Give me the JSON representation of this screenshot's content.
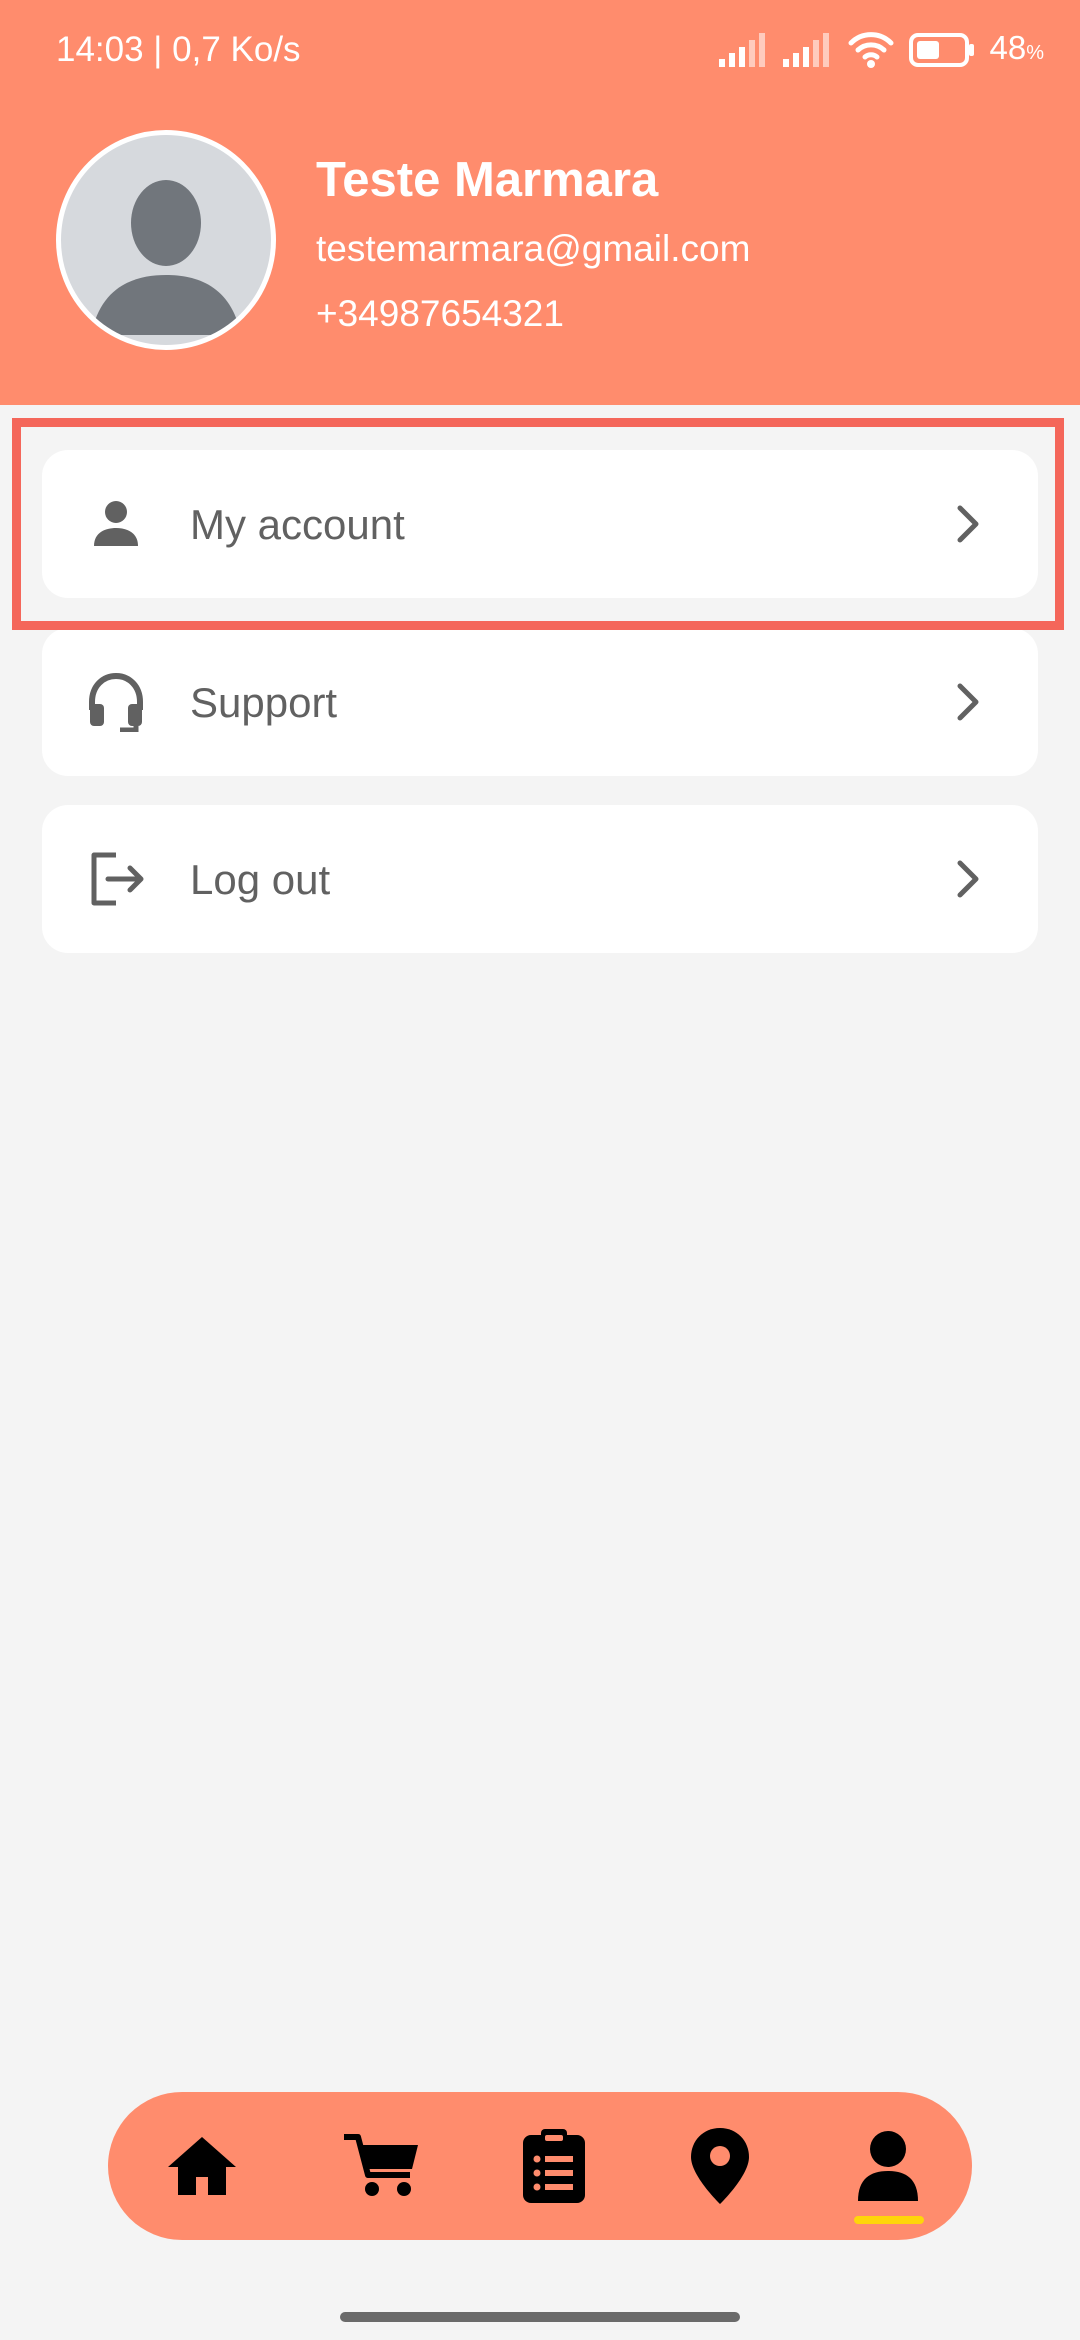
{
  "status_bar": {
    "time_speed": "14:03 | 0,7 Ko/s",
    "battery_level": "48",
    "battery_percent_sign": "%"
  },
  "profile": {
    "name": "Teste Marmara",
    "email": "testemarmara@gmail.com",
    "phone": "+34987654321"
  },
  "menu": {
    "items": [
      {
        "label": "My account",
        "icon": "person-icon"
      },
      {
        "label": "Support",
        "icon": "headset-icon"
      },
      {
        "label": "Log out",
        "icon": "logout-icon"
      }
    ]
  },
  "bottom_nav": {
    "items": [
      {
        "icon": "home-icon"
      },
      {
        "icon": "cart-icon"
      },
      {
        "icon": "clipboard-list-icon"
      },
      {
        "icon": "location-pin-icon"
      },
      {
        "icon": "user-icon",
        "active": true
      }
    ]
  },
  "colors": {
    "header": "#ff8c6d",
    "highlight": "#f4665a",
    "active_indicator": "#ffd60a",
    "background": "#f4f4f4"
  }
}
